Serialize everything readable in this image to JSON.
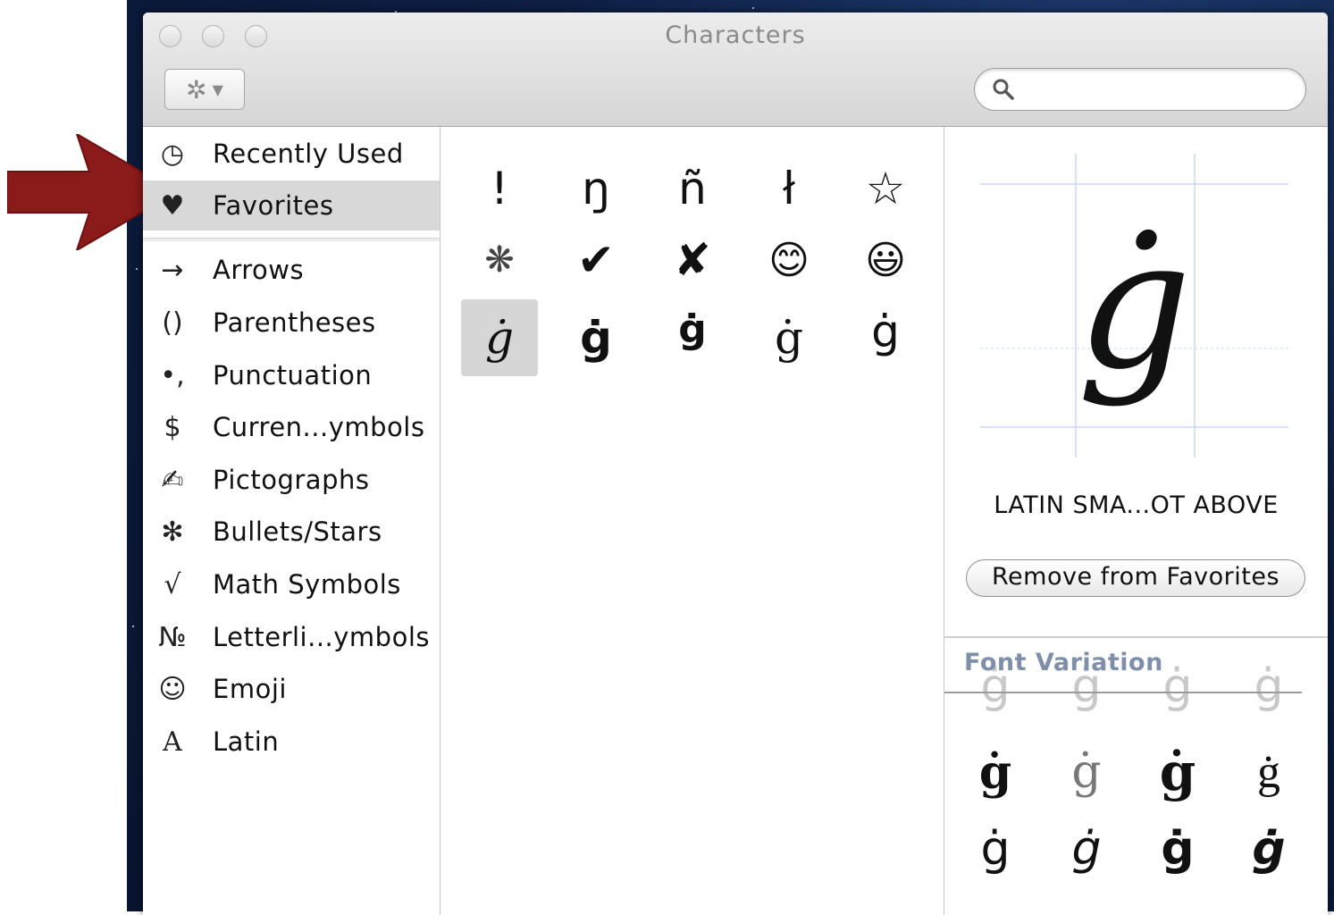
{
  "window": {
    "title": "Characters"
  },
  "toolbar": {
    "gear_icon": "gear-icon",
    "search_placeholder": ""
  },
  "sidebar": {
    "items": [
      {
        "icon": "◷",
        "label": "Recently Used",
        "selected": false
      },
      {
        "icon": "♥",
        "label": "Favorites",
        "selected": true
      },
      {
        "icon": "→",
        "label": "Arrows",
        "selected": false
      },
      {
        "icon": "()",
        "label": "Parentheses",
        "selected": false
      },
      {
        "icon": "•,",
        "label": "Punctuation",
        "selected": false
      },
      {
        "icon": "$",
        "label": "Curren...ymbols",
        "selected": false
      },
      {
        "icon": "✍",
        "label": "Pictographs",
        "selected": false
      },
      {
        "icon": "✻",
        "label": "Bullets/Stars",
        "selected": false
      },
      {
        "icon": "√",
        "label": "Math Symbols",
        "selected": false
      },
      {
        "icon": "№",
        "label": "Letterli...ymbols",
        "selected": false
      },
      {
        "icon": "☺",
        "label": "Emoji",
        "selected": false
      },
      {
        "icon": "A",
        "label": "Latin",
        "selected": false
      }
    ]
  },
  "favorites": {
    "characters": [
      "!",
      "ŋ",
      "ñ",
      "ł",
      "☆",
      "❋",
      "✔",
      "✘",
      "😊",
      "😃",
      "ġ",
      "ġ",
      "ġ",
      "ġ",
      "ġ"
    ],
    "selected_index": 10
  },
  "preview": {
    "glyph": "ġ",
    "name": "LATIN SMA...OT ABOVE",
    "favorite_button": "Remove from Favorites"
  },
  "font_variation": {
    "label": "Font Variation",
    "glyphs": [
      "ġ",
      "ġ",
      "ġ",
      "ġ",
      "ġ",
      "ġ",
      "ġ",
      "ġ",
      "ġ",
      "ġ",
      "ġ",
      "ġ"
    ]
  },
  "colors": {
    "arrow": "#8b1a1a",
    "selection": "#d8d8d8",
    "font_variation_label": "#7f8fa9"
  }
}
